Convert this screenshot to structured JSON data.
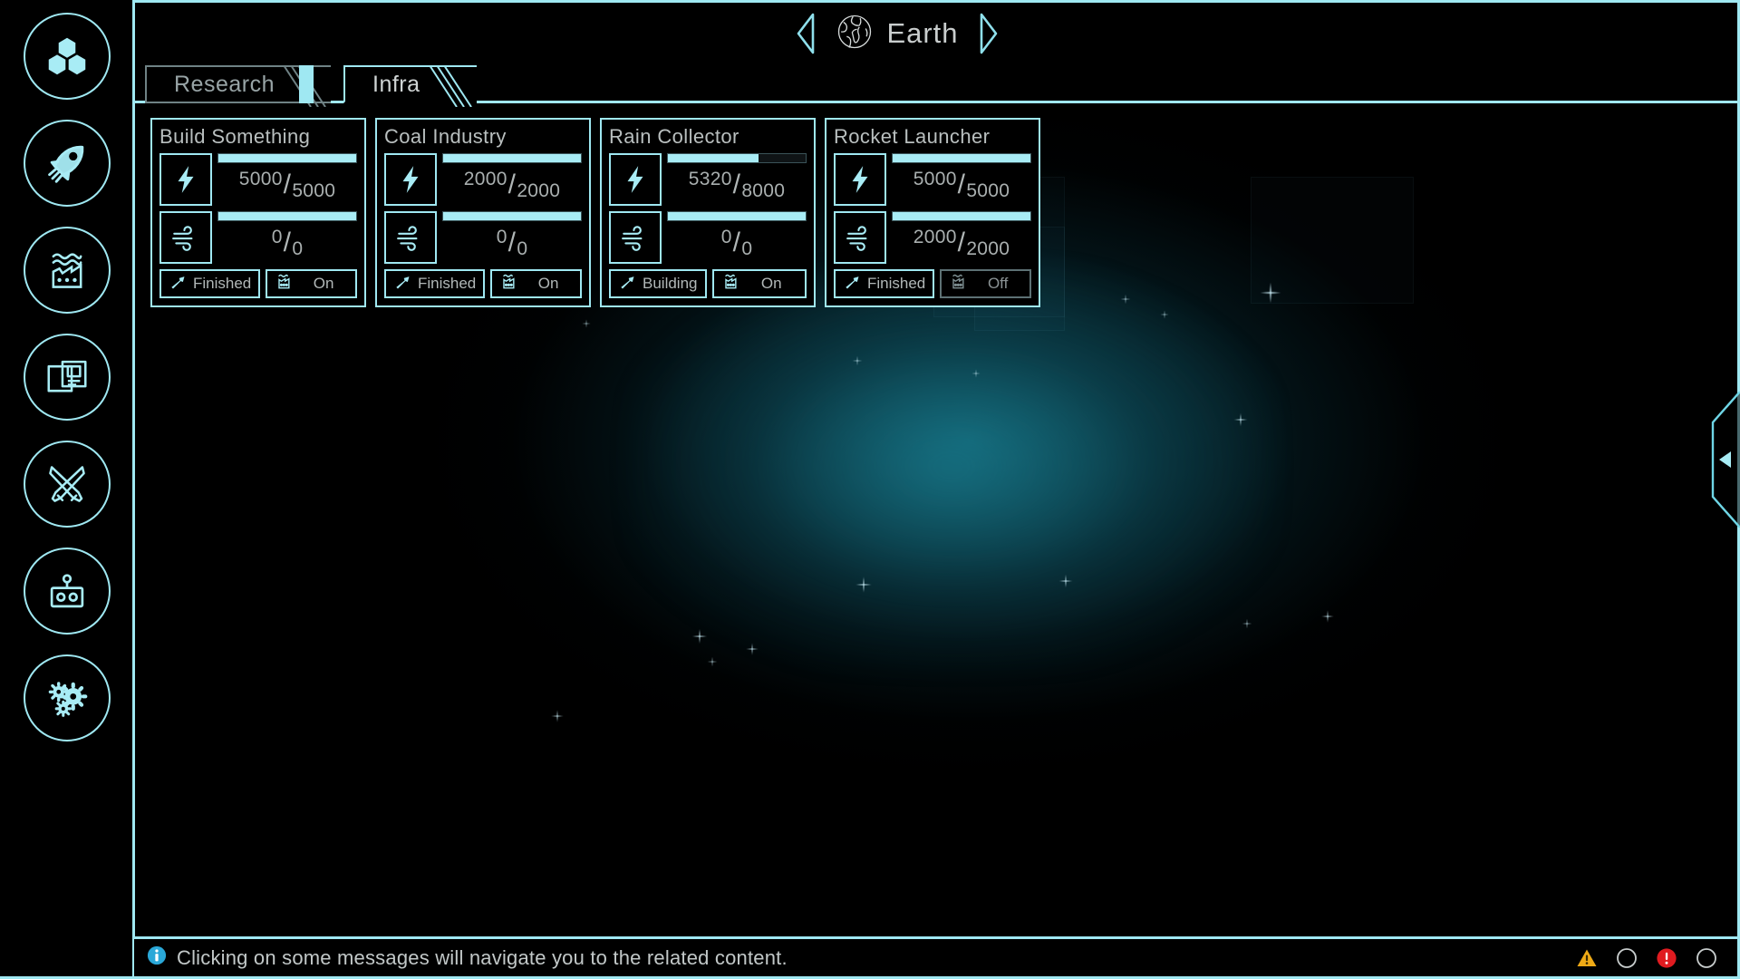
{
  "header": {
    "planet_name": "Earth",
    "prev_icon": "chevron-left-icon",
    "next_icon": "chevron-right-icon",
    "planet_icon": "globe-earth-icon"
  },
  "sidebar": {
    "items": [
      {
        "name": "resources",
        "icon": "hexagon-cluster-icon"
      },
      {
        "name": "space",
        "icon": "rocket-icon"
      },
      {
        "name": "production",
        "icon": "factory-water-icon"
      },
      {
        "name": "cards",
        "icon": "documents-icon"
      },
      {
        "name": "combat",
        "icon": "crossed-swords-icon"
      },
      {
        "name": "robots",
        "icon": "robot-icon"
      },
      {
        "name": "settings",
        "icon": "gears-icon"
      }
    ]
  },
  "tabs": [
    {
      "label": "Research",
      "active": false
    },
    {
      "label": "Infra",
      "active": true
    }
  ],
  "cards": [
    {
      "title": "Build Something",
      "power": {
        "icon": "lightning-bolt-icon",
        "current": "5000",
        "max": "5000",
        "percent": 100
      },
      "secondary": {
        "icon": "wind-icon",
        "current": "0",
        "max": "0",
        "percent": 100
      },
      "build_status": {
        "icon": "hammer-icon",
        "label": "Finished",
        "active": true
      },
      "power_toggle": {
        "icon": "factory-icon",
        "label": "On",
        "active": true
      }
    },
    {
      "title": "Coal Industry",
      "power": {
        "icon": "lightning-bolt-icon",
        "current": "2000",
        "max": "2000",
        "percent": 100
      },
      "secondary": {
        "icon": "wind-icon",
        "current": "0",
        "max": "0",
        "percent": 100
      },
      "build_status": {
        "icon": "hammer-icon",
        "label": "Finished",
        "active": true
      },
      "power_toggle": {
        "icon": "factory-icon",
        "label": "On",
        "active": true
      }
    },
    {
      "title": "Rain Collector",
      "power": {
        "icon": "lightning-bolt-icon",
        "current": "5320",
        "max": "8000",
        "percent": 66
      },
      "secondary": {
        "icon": "wind-icon",
        "current": "0",
        "max": "0",
        "percent": 100
      },
      "build_status": {
        "icon": "hammer-icon",
        "label": "Building",
        "active": true
      },
      "power_toggle": {
        "icon": "factory-icon",
        "label": "On",
        "active": true
      }
    },
    {
      "title": "Rocket Launcher",
      "power": {
        "icon": "lightning-bolt-icon",
        "current": "5000",
        "max": "5000",
        "percent": 100
      },
      "secondary": {
        "icon": "wind-icon",
        "current": "2000",
        "max": "2000",
        "percent": 100
      },
      "build_status": {
        "icon": "hammer-icon",
        "label": "Finished",
        "active": true
      },
      "power_toggle": {
        "icon": "factory-icon",
        "label": "Off",
        "active": false
      }
    }
  ],
  "side_panel": {
    "handle_icon": "triangle-left-icon"
  },
  "statusbar": {
    "info_icon": "info-circle-icon",
    "message": "Clicking on some messages will navigate you to the related content.",
    "indicators": [
      {
        "name": "warning",
        "icon": "warning-triangle-icon",
        "color": "#efaa16",
        "filled": true
      },
      {
        "name": "notice",
        "icon": "circle-outline-icon",
        "color": "#c8cdcd",
        "filled": false
      },
      {
        "name": "error",
        "icon": "error-circle-icon",
        "color": "#e01b20",
        "filled": true
      },
      {
        "name": "other",
        "icon": "circle-outline-icon",
        "color": "#c8cdcd",
        "filled": false
      }
    ]
  },
  "theme": {
    "accent": "#9fe8f2",
    "text": "#b9bfbf",
    "background": "#000000",
    "planet_glow": "#136878"
  }
}
